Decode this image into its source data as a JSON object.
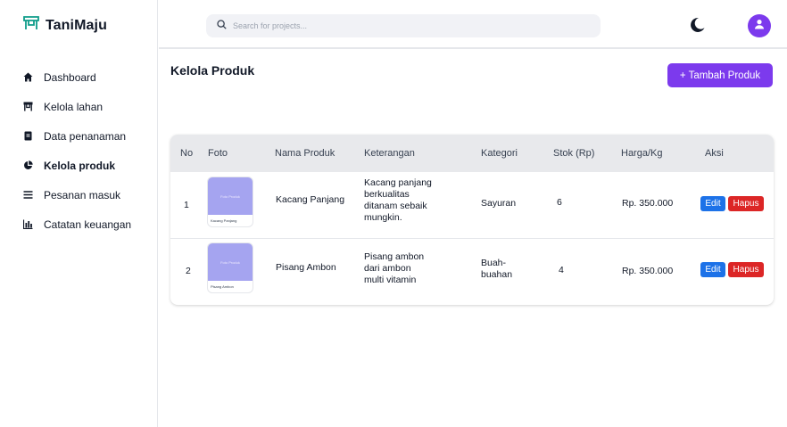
{
  "app": {
    "name": "TaniMaju",
    "logo_icon": "market-stall-icon",
    "accent": "#7c3aed"
  },
  "sidebar": {
    "items": [
      {
        "label": "Dashboard",
        "icon": "home-icon",
        "active": false
      },
      {
        "label": "Kelola lahan",
        "icon": "store-icon",
        "active": false
      },
      {
        "label": "Data penanaman",
        "icon": "clipboard-icon",
        "active": false
      },
      {
        "label": "Kelola produk",
        "icon": "pie-chart-icon",
        "active": true
      },
      {
        "label": "Pesanan masuk",
        "icon": "list-icon",
        "active": false
      },
      {
        "label": "Catatan keuangan",
        "icon": "bar-chart-icon",
        "active": false
      }
    ]
  },
  "topbar": {
    "search_placeholder": "Search for projects...",
    "theme_icon": "moon-icon",
    "user_icon": "user-icon"
  },
  "page": {
    "title": "Kelola Produk",
    "add_button": "+ Tambah Produk"
  },
  "table": {
    "headers": [
      "No",
      "Foto",
      "Nama Produk",
      "Keterangan",
      "Kategori",
      "Stok (Rp)",
      "Harga/Kg",
      "Aksi"
    ],
    "rows": [
      {
        "no": "1",
        "photo_text": "Foto Produk",
        "photo_caption": "Kacang Panjang",
        "name": "Kacang Panjang",
        "desc": [
          "Kacang panjang",
          "berkualitas",
          "ditanam sebaik",
          "mungkin."
        ],
        "category": [
          "Sayuran"
        ],
        "stock": "6",
        "price": "Rp. 350.000",
        "edit": "Edit",
        "delete": "Hapus"
      },
      {
        "no": "2",
        "photo_text": "Foto Produk",
        "photo_caption": "Pisang Ambon",
        "name": "Pisang Ambon",
        "desc": [
          "Pisang ambon",
          "dari ambon",
          "multi vitamin"
        ],
        "category": [
          "Buah-",
          "buahan"
        ],
        "stock": "4",
        "price": "Rp. 350.000",
        "edit": "Edit",
        "delete": "Hapus"
      }
    ]
  },
  "colors": {
    "edit": "#1d72e8",
    "delete": "#dc2626",
    "thumbnail": "#a5a4f0"
  }
}
